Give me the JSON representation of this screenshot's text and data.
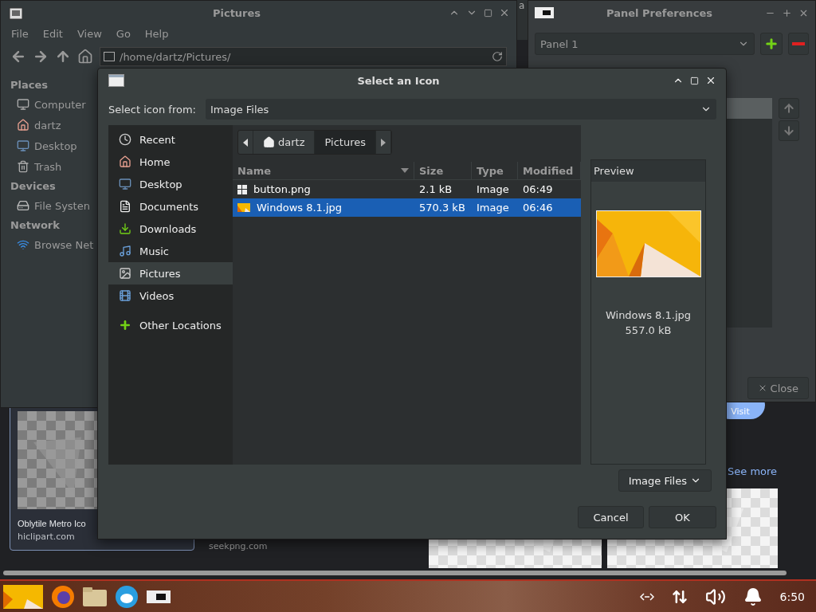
{
  "file_manager": {
    "title": "Pictures",
    "menu": [
      "File",
      "Edit",
      "View",
      "Go",
      "Help"
    ],
    "address": "/home/dartz/Pictures/",
    "sidebar": [
      {
        "heading": "Places",
        "items": [
          {
            "label": "Computer",
            "kind": "computer"
          },
          {
            "label": "dartz",
            "kind": "home"
          },
          {
            "label": "Desktop",
            "kind": "desktop"
          },
          {
            "label": "Trash",
            "kind": "trash"
          }
        ]
      },
      {
        "heading": "Devices",
        "items": [
          {
            "label": "File Systen",
            "kind": "drive"
          }
        ]
      },
      {
        "heading": "Network",
        "items": [
          {
            "label": "Browse Net",
            "kind": "network"
          }
        ]
      }
    ]
  },
  "fragment_window": {
    "title": "a"
  },
  "panel_preferences": {
    "title": "Panel Preferences",
    "panel_select": "Panel 1",
    "close_button": "Close"
  },
  "browser": {
    "cards": [
      {
        "title": "Oblytile Metro Ico",
        "source": "hiclipart.com",
        "selected": true
      },
      {
        "source": "seekpng.com"
      }
    ],
    "visit_button": "Visit",
    "see_more": "See more"
  },
  "dialog": {
    "title": "Select an Icon",
    "source_label": "Select icon from:",
    "source_value": "Image Files",
    "places": [
      {
        "label": "Recent",
        "kind": "recent",
        "selected": false
      },
      {
        "label": "Home",
        "kind": "home",
        "selected": false
      },
      {
        "label": "Desktop",
        "kind": "desktop",
        "selected": false
      },
      {
        "label": "Documents",
        "kind": "documents",
        "selected": false
      },
      {
        "label": "Downloads",
        "kind": "downloads",
        "selected": false
      },
      {
        "label": "Music",
        "kind": "music",
        "selected": false
      },
      {
        "label": "Pictures",
        "kind": "pictures",
        "selected": true
      },
      {
        "label": "Videos",
        "kind": "videos",
        "selected": false
      },
      {
        "label": "Other Locations",
        "kind": "other",
        "selected": false
      }
    ],
    "breadcrumb": [
      {
        "label": "dartz",
        "kind": "home",
        "selected": false
      },
      {
        "label": "Pictures",
        "kind": "folder",
        "selected": true
      }
    ],
    "columns": [
      "Name",
      "Size",
      "Type",
      "Modified"
    ],
    "files": [
      {
        "name": "button.png",
        "kind": "tiles",
        "size": "2.1 kB",
        "type": "Image",
        "modified": "06:49",
        "selected": false
      },
      {
        "name": "Windows 8.1.jpg",
        "size": "570.3 kB",
        "type": "Image",
        "modified": "06:46",
        "selected": true
      }
    ],
    "preview": {
      "title": "Preview",
      "name": "Windows 8.1.jpg",
      "size": "557.0 kB"
    },
    "filter": "Image Files",
    "buttons": [
      "Cancel",
      "OK"
    ]
  },
  "taskbar": {
    "time": "6:50"
  }
}
